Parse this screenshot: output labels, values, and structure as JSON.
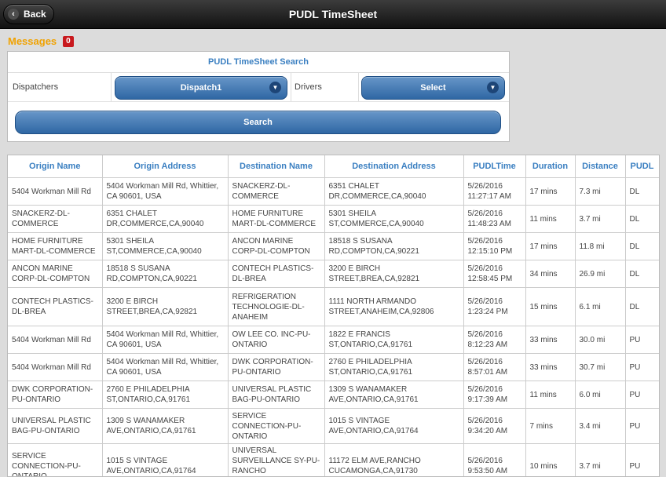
{
  "header": {
    "back_label": "Back",
    "title": "PUDL TimeSheet"
  },
  "messages": {
    "label": "Messages",
    "count": "0"
  },
  "search": {
    "title": "PUDL TimeSheet Search",
    "dispatchers_label": "Dispatchers",
    "dispatcher_value": "Dispatch1",
    "drivers_label": "Drivers",
    "driver_value": "Select",
    "search_label": "Search"
  },
  "table": {
    "columns": [
      "Origin Name",
      "Origin Address",
      "Destination Name",
      "Destination Address",
      "PUDLTime",
      "Duration",
      "Distance",
      "PUDL"
    ],
    "rows": [
      [
        "5404 Workman Mill Rd",
        "5404 Workman Mill Rd, Whittier, CA 90601, USA",
        "SNACKERZ-DL-COMMERCE",
        "6351 CHALET DR,COMMERCE,CA,90040",
        "5/26/2016 11:27:17 AM",
        "17 mins",
        "7.3 mi",
        "DL"
      ],
      [
        "SNACKERZ-DL-COMMERCE",
        "6351 CHALET DR,COMMERCE,CA,90040",
        "HOME FURNITURE MART-DL-COMMERCE",
        "5301 SHEILA ST,COMMERCE,CA,90040",
        "5/26/2016 11:48:23 AM",
        "11 mins",
        "3.7 mi",
        "DL"
      ],
      [
        "HOME FURNITURE MART-DL-COMMERCE",
        "5301 SHEILA ST,COMMERCE,CA,90040",
        "ANCON MARINE CORP-DL-COMPTON",
        "18518 S SUSANA RD,COMPTON,CA,90221",
        "5/26/2016 12:15:10 PM",
        "17 mins",
        "11.8 mi",
        "DL"
      ],
      [
        "ANCON MARINE CORP-DL-COMPTON",
        "18518 S SUSANA RD,COMPTON,CA,90221",
        "CONTECH PLASTICS-DL-BREA",
        "3200 E BIRCH STREET,BREA,CA,92821",
        "5/26/2016 12:58:45 PM",
        "34 mins",
        "26.9 mi",
        "DL"
      ],
      [
        "CONTECH PLASTICS-DL-BREA",
        "3200 E BIRCH STREET,BREA,CA,92821",
        "REFRIGERATION TECHNOLOGIE-DL-ANAHEIM",
        "1111 NORTH ARMANDO STREET,ANAHEIM,CA,92806",
        "5/26/2016 1:23:24 PM",
        "15 mins",
        "6.1 mi",
        "DL"
      ],
      [
        "5404 Workman Mill Rd",
        "5404 Workman Mill Rd, Whittier, CA 90601, USA",
        "OW LEE CO. INC-PU-ONTARIO",
        "1822 E FRANCIS ST,ONTARIO,CA,91761",
        "5/26/2016 8:12:23 AM",
        "33 mins",
        "30.0 mi",
        "PU"
      ],
      [
        "5404 Workman Mill Rd",
        "5404 Workman Mill Rd, Whittier, CA 90601, USA",
        "DWK CORPORATION-PU-ONTARIO",
        "2760 E PHILADELPHIA ST,ONTARIO,CA,91761",
        "5/26/2016 8:57:01 AM",
        "33 mins",
        "30.7 mi",
        "PU"
      ],
      [
        "DWK CORPORATION-PU-ONTARIO",
        "2760 E PHILADELPHIA ST,ONTARIO,CA,91761",
        "UNIVERSAL PLASTIC BAG-PU-ONTARIO",
        "1309 S WANAMAKER AVE,ONTARIO,CA,91761",
        "5/26/2016 9:17:39 AM",
        "11 mins",
        "6.0 mi",
        "PU"
      ],
      [
        "UNIVERSAL PLASTIC BAG-PU-ONTARIO",
        "1309 S WANAMAKER AVE,ONTARIO,CA,91761",
        "SERVICE CONNECTION-PU-ONTARIO",
        "1015 S VINTAGE AVE,ONTARIO,CA,91764",
        "5/26/2016 9:34:20 AM",
        "7 mins",
        "3.4 mi",
        "PU"
      ],
      [
        "SERVICE CONNECTION-PU-ONTARIO",
        "1015 S VINTAGE AVE,ONTARIO,CA,91764",
        "UNIVERSAL SURVEILLANCE SY-PU-RANCHO CUCAMONGA",
        "11172 ELM AVE,RANCHO CUCAMONGA,CA,91730",
        "5/26/2016 9:53:50 AM",
        "10 mins",
        "3.7 mi",
        "PU"
      ]
    ]
  }
}
